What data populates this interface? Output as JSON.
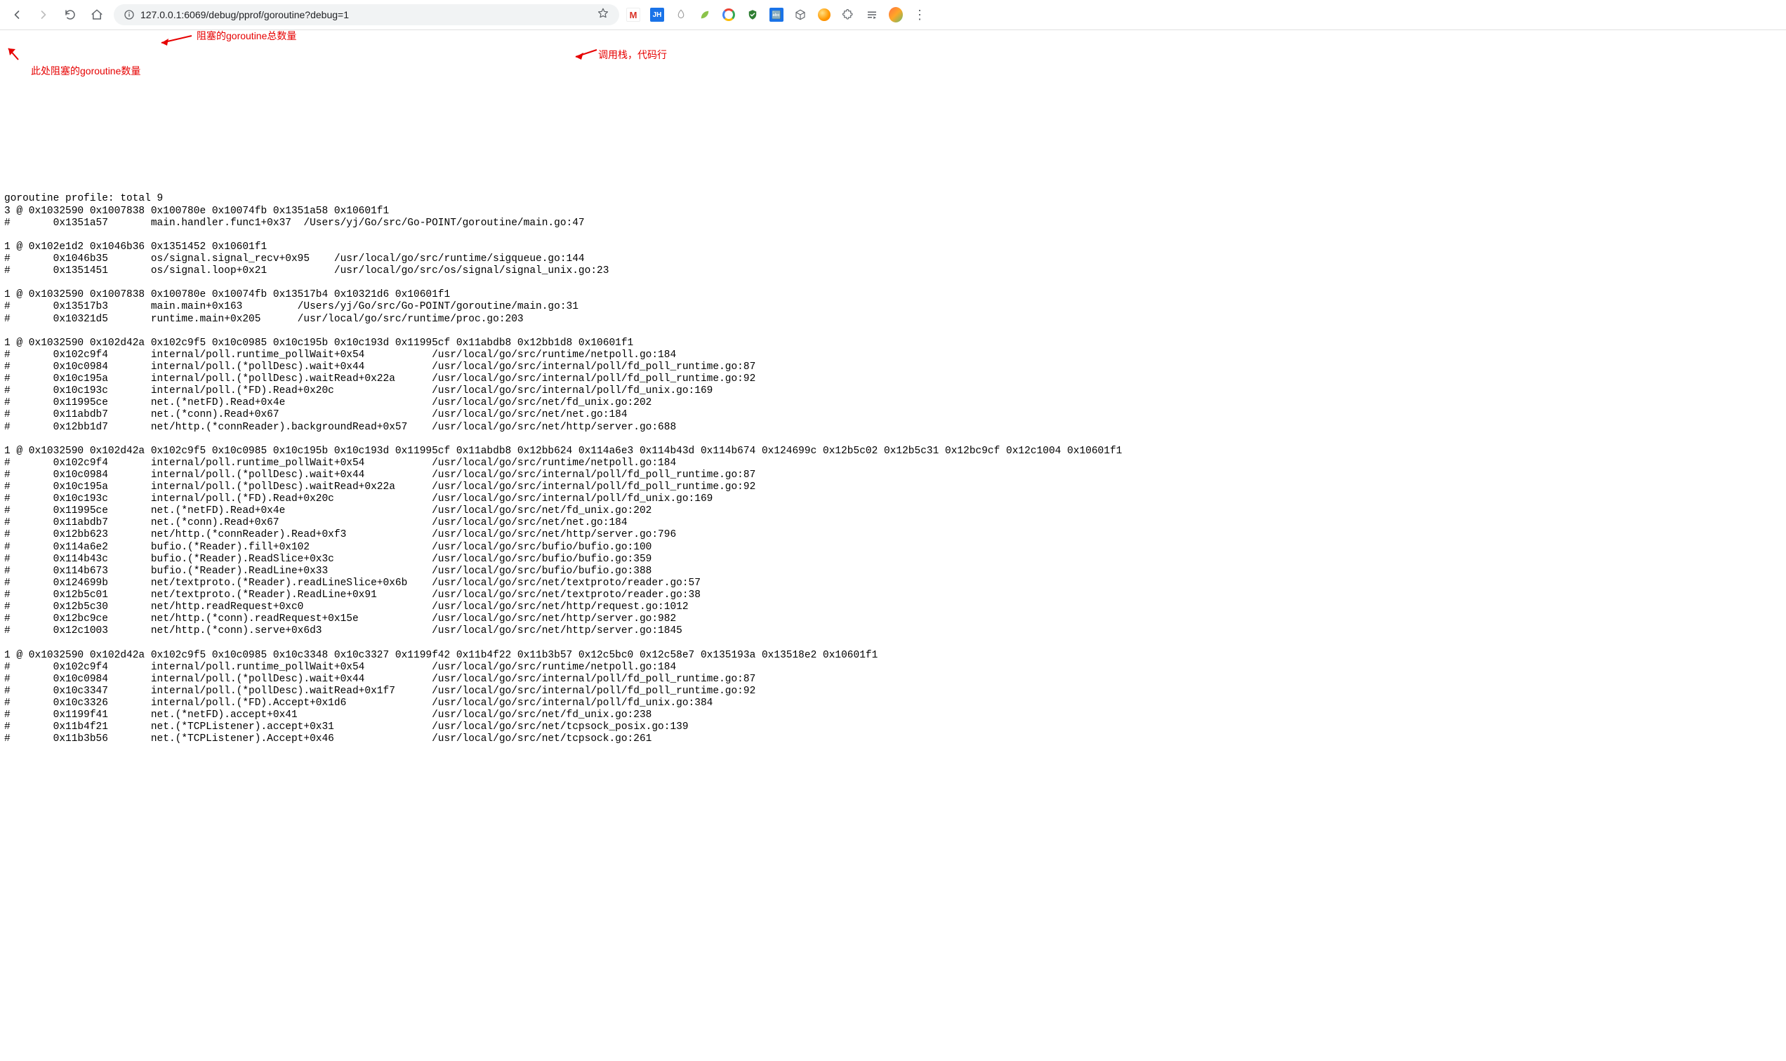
{
  "browser": {
    "url": "127.0.0.1:6069/debug/pprof/goroutine?debug=1"
  },
  "annotations": {
    "total_label": "阻塞的goroutine总数量",
    "here_blocked_label": "此处阻塞的goroutine数量",
    "callstack_label": "调用栈，代码行"
  },
  "profile": {
    "header": "goroutine profile: total 9",
    "groups": [
      {
        "count": 3,
        "pcs": "0x1032590 0x1007838 0x100780e 0x10074fb 0x1351a58 0x10601f1",
        "frames": [
          {
            "addr": "0x1351a57",
            "func": "main.handler.func1+0x37",
            "file": "/Users/yj/Go/src/Go-POINT/goroutine/main.go:47"
          }
        ]
      },
      {
        "count": 1,
        "pcs": "0x102e1d2 0x1046b36 0x1351452 0x10601f1",
        "frames": [
          {
            "addr": "0x1046b35",
            "func": "os/signal.signal_recv+0x95",
            "file": "/usr/local/go/src/runtime/sigqueue.go:144"
          },
          {
            "addr": "0x1351451",
            "func": "os/signal.loop+0x21",
            "file": "/usr/local/go/src/os/signal/signal_unix.go:23"
          }
        ]
      },
      {
        "count": 1,
        "pcs": "0x1032590 0x1007838 0x100780e 0x10074fb 0x13517b4 0x10321d6 0x10601f1",
        "frames": [
          {
            "addr": "0x13517b3",
            "func": "main.main+0x163",
            "file": "/Users/yj/Go/src/Go-POINT/goroutine/main.go:31"
          },
          {
            "addr": "0x10321d5",
            "func": "runtime.main+0x205",
            "file": "/usr/local/go/src/runtime/proc.go:203"
          }
        ]
      },
      {
        "count": 1,
        "pcs": "0x1032590 0x102d42a 0x102c9f5 0x10c0985 0x10c195b 0x10c193d 0x11995cf 0x11abdb8 0x12bb1d8 0x10601f1",
        "frames": [
          {
            "addr": "0x102c9f4",
            "func": "internal/poll.runtime_pollWait+0x54",
            "file": "/usr/local/go/src/runtime/netpoll.go:184"
          },
          {
            "addr": "0x10c0984",
            "func": "internal/poll.(*pollDesc).wait+0x44",
            "file": "/usr/local/go/src/internal/poll/fd_poll_runtime.go:87"
          },
          {
            "addr": "0x10c195a",
            "func": "internal/poll.(*pollDesc).waitRead+0x22a",
            "file": "/usr/local/go/src/internal/poll/fd_poll_runtime.go:92"
          },
          {
            "addr": "0x10c193c",
            "func": "internal/poll.(*FD).Read+0x20c",
            "file": "/usr/local/go/src/internal/poll/fd_unix.go:169"
          },
          {
            "addr": "0x11995ce",
            "func": "net.(*netFD).Read+0x4e",
            "file": "/usr/local/go/src/net/fd_unix.go:202"
          },
          {
            "addr": "0x11abdb7",
            "func": "net.(*conn).Read+0x67",
            "file": "/usr/local/go/src/net/net.go:184"
          },
          {
            "addr": "0x12bb1d7",
            "func": "net/http.(*connReader).backgroundRead+0x57",
            "file": "/usr/local/go/src/net/http/server.go:688"
          }
        ]
      },
      {
        "count": 1,
        "pcs": "0x1032590 0x102d42a 0x102c9f5 0x10c0985 0x10c195b 0x10c193d 0x11995cf 0x11abdb8 0x12bb624 0x114a6e3 0x114b43d 0x114b674 0x124699c 0x12b5c02 0x12b5c31 0x12bc9cf 0x12c1004 0x10601f1",
        "frames": [
          {
            "addr": "0x102c9f4",
            "func": "internal/poll.runtime_pollWait+0x54",
            "file": "/usr/local/go/src/runtime/netpoll.go:184"
          },
          {
            "addr": "0x10c0984",
            "func": "internal/poll.(*pollDesc).wait+0x44",
            "file": "/usr/local/go/src/internal/poll/fd_poll_runtime.go:87"
          },
          {
            "addr": "0x10c195a",
            "func": "internal/poll.(*pollDesc).waitRead+0x22a",
            "file": "/usr/local/go/src/internal/poll/fd_poll_runtime.go:92"
          },
          {
            "addr": "0x10c193c",
            "func": "internal/poll.(*FD).Read+0x20c",
            "file": "/usr/local/go/src/internal/poll/fd_unix.go:169"
          },
          {
            "addr": "0x11995ce",
            "func": "net.(*netFD).Read+0x4e",
            "file": "/usr/local/go/src/net/fd_unix.go:202"
          },
          {
            "addr": "0x11abdb7",
            "func": "net.(*conn).Read+0x67",
            "file": "/usr/local/go/src/net/net.go:184"
          },
          {
            "addr": "0x12bb623",
            "func": "net/http.(*connReader).Read+0xf3",
            "file": "/usr/local/go/src/net/http/server.go:796"
          },
          {
            "addr": "0x114a6e2",
            "func": "bufio.(*Reader).fill+0x102",
            "file": "/usr/local/go/src/bufio/bufio.go:100"
          },
          {
            "addr": "0x114b43c",
            "func": "bufio.(*Reader).ReadSlice+0x3c",
            "file": "/usr/local/go/src/bufio/bufio.go:359"
          },
          {
            "addr": "0x114b673",
            "func": "bufio.(*Reader).ReadLine+0x33",
            "file": "/usr/local/go/src/bufio/bufio.go:388"
          },
          {
            "addr": "0x124699b",
            "func": "net/textproto.(*Reader).readLineSlice+0x6b",
            "file": "/usr/local/go/src/net/textproto/reader.go:57"
          },
          {
            "addr": "0x12b5c01",
            "func": "net/textproto.(*Reader).ReadLine+0x91",
            "file": "/usr/local/go/src/net/textproto/reader.go:38"
          },
          {
            "addr": "0x12b5c30",
            "func": "net/http.readRequest+0xc0",
            "file": "/usr/local/go/src/net/http/request.go:1012"
          },
          {
            "addr": "0x12bc9ce",
            "func": "net/http.(*conn).readRequest+0x15e",
            "file": "/usr/local/go/src/net/http/server.go:982"
          },
          {
            "addr": "0x12c1003",
            "func": "net/http.(*conn).serve+0x6d3",
            "file": "/usr/local/go/src/net/http/server.go:1845"
          }
        ]
      },
      {
        "count": 1,
        "pcs": "0x1032590 0x102d42a 0x102c9f5 0x10c0985 0x10c3348 0x10c3327 0x1199f42 0x11b4f22 0x11b3b57 0x12c5bc0 0x12c58e7 0x135193a 0x13518e2 0x10601f1",
        "frames": [
          {
            "addr": "0x102c9f4",
            "func": "internal/poll.runtime_pollWait+0x54",
            "file": "/usr/local/go/src/runtime/netpoll.go:184"
          },
          {
            "addr": "0x10c0984",
            "func": "internal/poll.(*pollDesc).wait+0x44",
            "file": "/usr/local/go/src/internal/poll/fd_poll_runtime.go:87"
          },
          {
            "addr": "0x10c3347",
            "func": "internal/poll.(*pollDesc).waitRead+0x1f7",
            "file": "/usr/local/go/src/internal/poll/fd_poll_runtime.go:92"
          },
          {
            "addr": "0x10c3326",
            "func": "internal/poll.(*FD).Accept+0x1d6",
            "file": "/usr/local/go/src/internal/poll/fd_unix.go:384"
          },
          {
            "addr": "0x1199f41",
            "func": "net.(*netFD).accept+0x41",
            "file": "/usr/local/go/src/net/fd_unix.go:238"
          },
          {
            "addr": "0x11b4f21",
            "func": "net.(*TCPListener).accept+0x31",
            "file": "/usr/local/go/src/net/tcpsock_posix.go:139"
          },
          {
            "addr": "0x11b3b56",
            "func": "net.(*TCPListener).Accept+0x46",
            "file": "/usr/local/go/src/net/tcpsock.go:261"
          }
        ]
      }
    ]
  }
}
